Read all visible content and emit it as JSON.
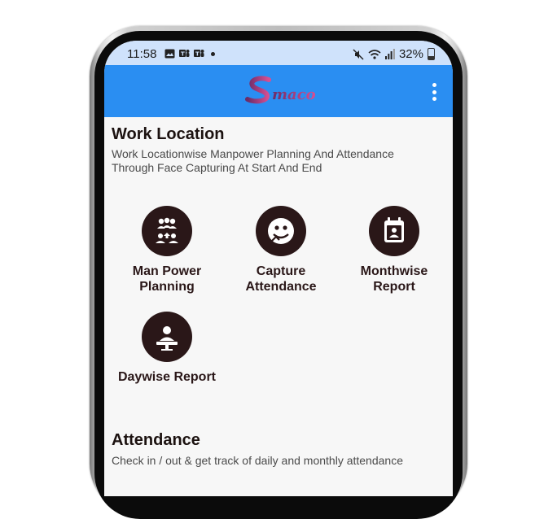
{
  "status_bar": {
    "time": "11:58",
    "battery": "32%"
  },
  "app_bar": {
    "logo_text": "Smaco"
  },
  "work_location": {
    "title": "Work Location",
    "subtitle_line1": "Work Locationwise Manpower Planning And Attendance",
    "subtitle_line2": "Through Face Capturing At Start And End",
    "tiles": [
      {
        "line1": "Man Power",
        "line2": "Planning"
      },
      {
        "line1": "Capture",
        "line2": "Attendance"
      },
      {
        "line1": "Monthwise",
        "line2": "Report"
      },
      {
        "line1": "Daywise Report",
        "line2": ""
      }
    ]
  },
  "attendance": {
    "title": "Attendance",
    "subtitle": "Check in / out & get track of daily and monthly attendance"
  },
  "colors": {
    "app_bar": "#2a8ef2",
    "status_bar": "#cfe2fb",
    "icon_circle": "#2a1718",
    "logo_gradient": [
      "#7b2d6b",
      "#d24b8f"
    ]
  }
}
